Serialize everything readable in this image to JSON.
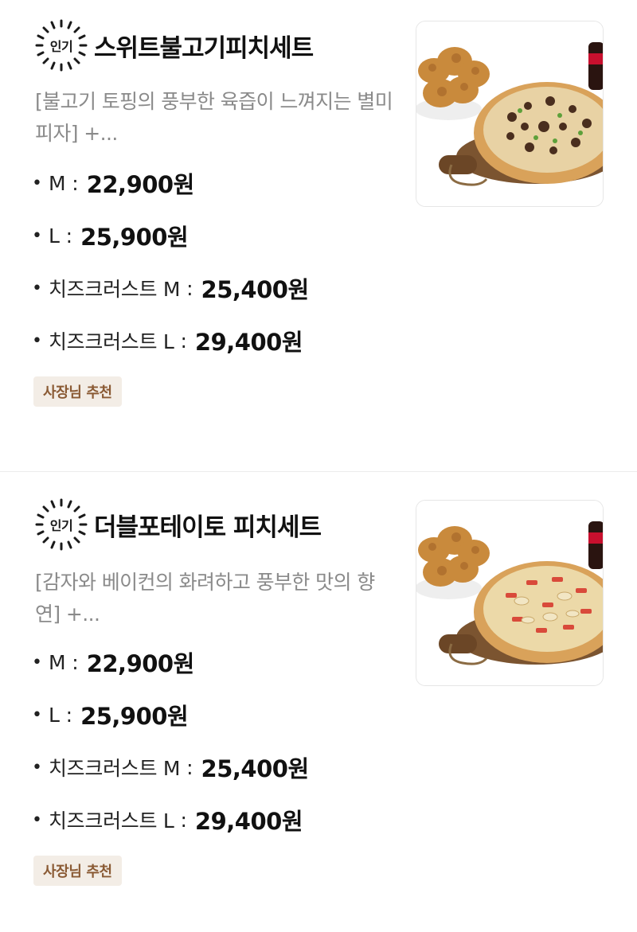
{
  "items": [
    {
      "badge": "인기",
      "title": "스위트불고기피치세트",
      "description": "[불고기 토핑의 풍부한 육즙이 느껴지는 별미 피자] +...",
      "prices": [
        {
          "label": "M",
          "price": "22,900원"
        },
        {
          "label": "L",
          "price": "25,900원"
        },
        {
          "label": "치즈크러스트 M",
          "price": "25,400원"
        },
        {
          "label": "치즈크러스트 L",
          "price": "29,400원"
        }
      ],
      "tag": "사장님 추천",
      "image_icon": "bulgogi-pizza-chicken-image"
    },
    {
      "badge": "인기",
      "title": "더블포테이토 피치세트",
      "description": "[감자와 베이컨의 화려하고 풍부한 맛의 향연] +...",
      "prices": [
        {
          "label": "M",
          "price": "22,900원"
        },
        {
          "label": "L",
          "price": "25,900원"
        },
        {
          "label": "치즈크러스트 M",
          "price": "25,400원"
        },
        {
          "label": "치즈크러스트 L",
          "price": "29,400원"
        }
      ],
      "tag": "사장님 추천",
      "image_icon": "potato-pizza-chicken-image"
    }
  ],
  "colors": {
    "tag_background": "#f3ede6",
    "tag_text": "#8a5a34",
    "description_text": "#8a8a8a"
  }
}
